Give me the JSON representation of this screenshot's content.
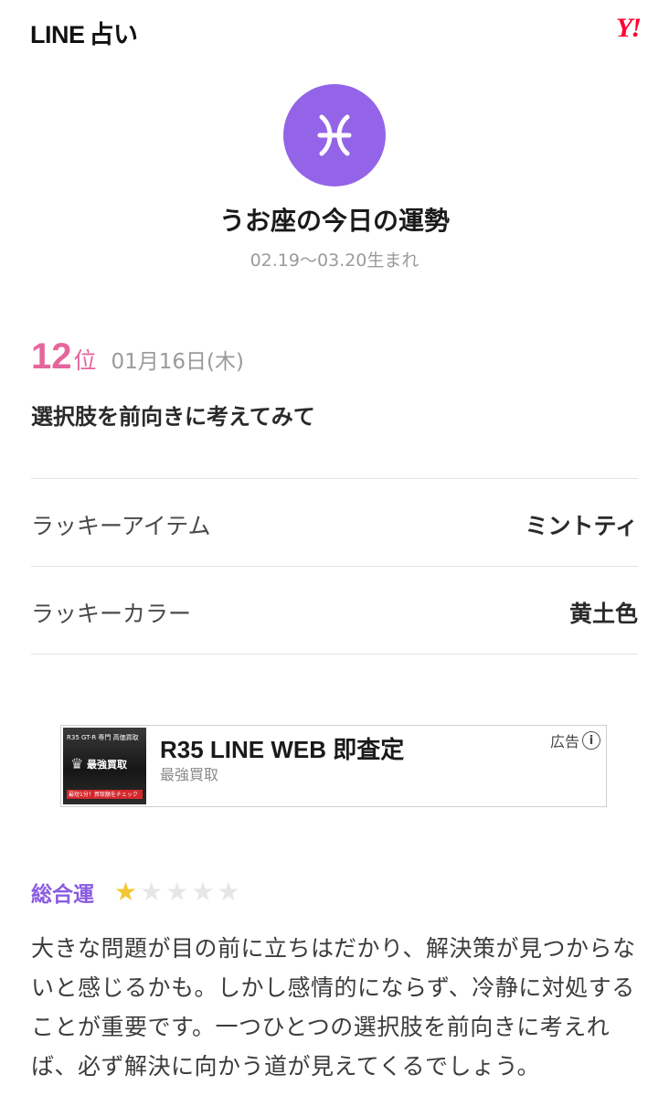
{
  "header": {
    "logo_line": "LINE",
    "logo_uranai": "占い",
    "partner_logo": "Y!"
  },
  "sign": {
    "icon": "pisces-icon",
    "color": "#9464e8",
    "title": "うお座の今日の運勢",
    "birth_range": "02.19〜03.20生まれ"
  },
  "ranking": {
    "rank": "12",
    "rank_unit": "位",
    "date": "01月16日(木)",
    "headline": "選択肢を前向きに考えてみて"
  },
  "lucky": {
    "item_label": "ラッキーアイテム",
    "item_value": "ミントティ",
    "color_label": "ラッキーカラー",
    "color_value": "黄土色"
  },
  "ad": {
    "thumb_line1": "R35 GT-R 専門 高価買取",
    "thumb_brand": "最強買取",
    "thumb_cta": "最短1分！買取額をチェック",
    "title": "R35 LINE WEB 即査定",
    "subtitle": "最強買取",
    "badge": "広告"
  },
  "fortune": {
    "label": "総合運",
    "rating": 1,
    "rating_max": 5,
    "star_color": "#f3c734",
    "text": "大きな問題が目の前に立ちはだかり、解決策が見つからないと感じるかも。しかし感情的にならず、冷静に対処することが重要です。一つひとつの選択肢を前向きに考えれば、必ず解決に向かう道が見えてくるでしょう。"
  }
}
